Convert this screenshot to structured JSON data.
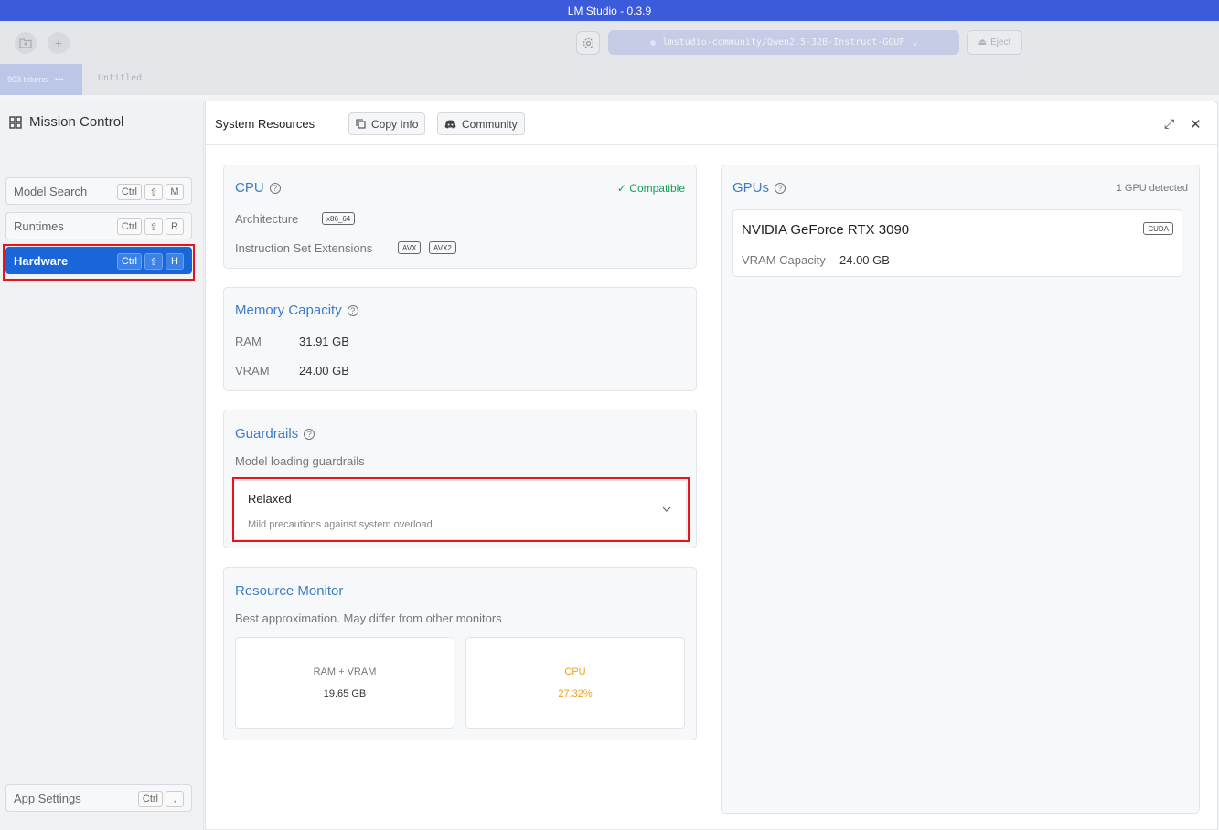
{
  "window": {
    "title": "LM Studio - 0.3.9"
  },
  "topbar": {
    "model": "lmstudio-community/Qwen2.5-32B-Instruct-GGUF",
    "eject_label": "Eject",
    "chevron": "⌄"
  },
  "tabs": {
    "tokens": "903 tokens",
    "more": "•••",
    "untitled": "Untitled"
  },
  "sidebar": {
    "title": "Mission Control",
    "items": [
      {
        "label": "Model Search",
        "keys": [
          "Ctrl",
          "⇧",
          "M"
        ]
      },
      {
        "label": "Runtimes",
        "keys": [
          "Ctrl",
          "⇧",
          "R"
        ]
      },
      {
        "label": "Hardware",
        "keys": [
          "Ctrl",
          "⇧",
          "H"
        ]
      }
    ],
    "settings": {
      "label": "App Settings",
      "keys": [
        "Ctrl",
        ","
      ]
    }
  },
  "header": {
    "title": "System Resources",
    "copy_info": "Copy Info",
    "community": "Community"
  },
  "cpu": {
    "title": "CPU",
    "status": "✓ Compatible",
    "architecture_label": "Architecture",
    "architecture_value": "x86_64",
    "extensions_label": "Instruction Set Extensions",
    "extensions": [
      "AVX",
      "AVX2"
    ]
  },
  "memory": {
    "title": "Memory Capacity",
    "ram_label": "RAM",
    "ram_value": "31.91 GB",
    "vram_label": "VRAM",
    "vram_value": "24.00 GB"
  },
  "guardrails": {
    "title": "Guardrails",
    "subtitle": "Model loading guardrails",
    "selected": "Relaxed",
    "selected_description": "Mild precautions against system overload"
  },
  "monitor": {
    "title": "Resource Monitor",
    "subtitle": "Best approximation. May differ from other monitors",
    "ram_label": "RAM + VRAM",
    "ram_value": "19.65 GB",
    "cpu_label": "CPU",
    "cpu_value": "27.32%"
  },
  "gpus": {
    "title": "GPUs",
    "count": "1 GPU detected",
    "device": {
      "name": "NVIDIA GeForce RTX 3090",
      "badge": "CUDA",
      "vram_label": "VRAM Capacity",
      "vram_value": "24.00 GB"
    }
  },
  "colors": {
    "accent": "#1a66d9",
    "title_blue": "#3d7cc9",
    "compatible": "#1a9a5a",
    "cpu_usage": "#f0a020",
    "highlight": "#e8141b"
  }
}
